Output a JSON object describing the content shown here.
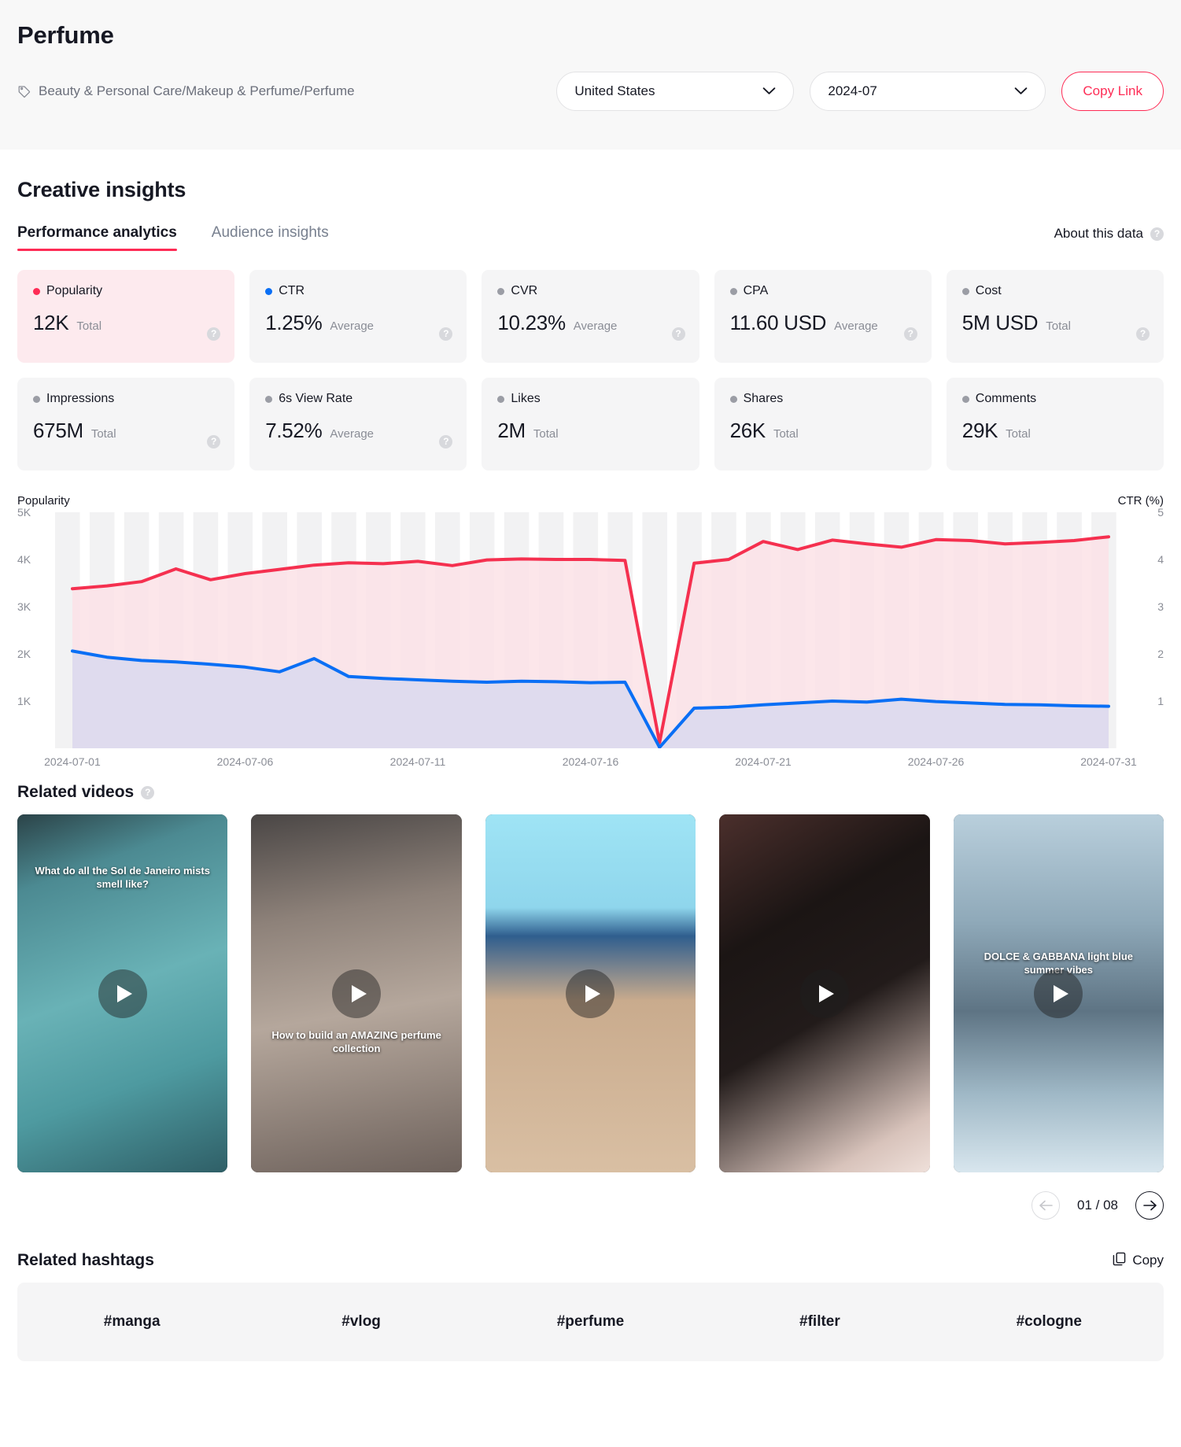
{
  "header": {
    "title": "Perfume",
    "breadcrumb": "Beauty & Personal Care/Makeup & Perfume/Perfume",
    "tag_icon": "tag-icon",
    "country_select": "United States",
    "period_select": "2024-07",
    "copy_link_label": "Copy Link",
    "chevron_icon": "chevron-down-icon"
  },
  "insights": {
    "section_title": "Creative insights",
    "tabs": [
      {
        "label": "Performance analytics",
        "active": true
      },
      {
        "label": "Audience insights",
        "active": false
      }
    ],
    "about_label": "About this data",
    "help_icon": "question-mark-icon",
    "accent_color": "#fe2c55",
    "blue_color": "#0a6ff5"
  },
  "metrics": [
    {
      "label": "Popularity",
      "value": "12K",
      "unit": "Total",
      "dot": "red",
      "highlight": true
    },
    {
      "label": "CTR",
      "value": "1.25%",
      "unit": "Average",
      "dot": "blue",
      "highlight": false
    },
    {
      "label": "CVR",
      "value": "10.23%",
      "unit": "Average",
      "dot": "grey",
      "highlight": false
    },
    {
      "label": "CPA",
      "value": "11.60 USD",
      "unit": "Average",
      "dot": "grey",
      "highlight": false
    },
    {
      "label": "Cost",
      "value": "5M USD",
      "unit": "Total",
      "dot": "grey",
      "highlight": false
    },
    {
      "label": "Impressions",
      "value": "675M",
      "unit": "Total",
      "dot": "grey",
      "highlight": false
    },
    {
      "label": "6s View Rate",
      "value": "7.52%",
      "unit": "Average",
      "dot": "grey",
      "highlight": false
    },
    {
      "label": "Likes",
      "value": "2M",
      "unit": "Total",
      "dot": "grey",
      "highlight": false
    },
    {
      "label": "Shares",
      "value": "26K",
      "unit": "Total",
      "dot": "grey",
      "highlight": false
    },
    {
      "label": "Comments",
      "value": "29K",
      "unit": "Total",
      "dot": "grey",
      "highlight": false
    }
  ],
  "chart_data": {
    "type": "area",
    "title": "",
    "left_axis_label": "Popularity",
    "right_axis_label": "CTR (%)",
    "xlabel": "",
    "grid": true,
    "legend_position": "none",
    "x": [
      "2024-07-01",
      "2024-07-02",
      "2024-07-03",
      "2024-07-04",
      "2024-07-05",
      "2024-07-06",
      "2024-07-07",
      "2024-07-08",
      "2024-07-09",
      "2024-07-10",
      "2024-07-11",
      "2024-07-12",
      "2024-07-13",
      "2024-07-14",
      "2024-07-15",
      "2024-07-16",
      "2024-07-17",
      "2024-07-18",
      "2024-07-19",
      "2024-07-20",
      "2024-07-21",
      "2024-07-22",
      "2024-07-23",
      "2024-07-24",
      "2024-07-25",
      "2024-07-26",
      "2024-07-27",
      "2024-07-28",
      "2024-07-29",
      "2024-07-30",
      "2024-07-31"
    ],
    "x_tick_labels": [
      "2024-07-01",
      "2024-07-06",
      "2024-07-11",
      "2024-07-16",
      "2024-07-21",
      "2024-07-26",
      "2024-07-31"
    ],
    "x_tick_indices": [
      0,
      5,
      10,
      15,
      20,
      25,
      30
    ],
    "left_axis": {
      "label": "Popularity",
      "ticks": [
        "1K",
        "2K",
        "3K",
        "4K",
        "5K"
      ],
      "tick_values": [
        1000,
        2000,
        3000,
        4000,
        5000
      ],
      "min": 0,
      "max": 5000
    },
    "right_axis": {
      "label": "CTR (%)",
      "ticks": [
        "1",
        "2",
        "3",
        "4",
        "5"
      ],
      "tick_values": [
        1,
        2,
        3,
        4,
        5
      ],
      "min": 0,
      "max": 5
    },
    "series": [
      {
        "name": "Popularity",
        "color": "#f5304f",
        "fill": "#fbe2e6",
        "axis": "left",
        "values": [
          3380,
          3440,
          3530,
          3800,
          3570,
          3700,
          3790,
          3880,
          3930,
          3910,
          3960,
          3870,
          3990,
          4010,
          4000,
          4000,
          3980,
          120,
          3920,
          4000,
          4380,
          4210,
          4410,
          4330,
          4260,
          4420,
          4400,
          4330,
          4360,
          4400,
          4480
        ]
      },
      {
        "name": "CTR",
        "color": "#0a6ff5",
        "fill": "#dcd9ee",
        "axis": "right",
        "values": [
          2.06,
          1.93,
          1.86,
          1.83,
          1.78,
          1.72,
          1.62,
          1.9,
          1.52,
          1.48,
          1.45,
          1.42,
          1.4,
          1.42,
          1.41,
          1.39,
          1.4,
          0.02,
          0.85,
          0.87,
          0.92,
          0.96,
          1.0,
          0.98,
          1.04,
          0.99,
          0.96,
          0.93,
          0.92,
          0.9,
          0.89
        ]
      }
    ]
  },
  "related_videos": {
    "title": "Related videos",
    "help_icon": "question-mark-icon",
    "items": [
      {
        "caption": "What do all the Sol de Janeiro mists smell like?",
        "play_icon": "play-icon"
      },
      {
        "caption": "How to build an AMAZING perfume collection",
        "play_icon": "play-icon"
      },
      {
        "caption": "",
        "play_icon": "play-icon"
      },
      {
        "caption": "",
        "play_icon": "play-icon"
      },
      {
        "caption": "DOLCE & GABBANA light blue summer vibes",
        "play_icon": "play-icon"
      }
    ],
    "pager": {
      "counter": "01 / 08",
      "prev_icon": "arrow-left-icon",
      "next_icon": "arrow-right-icon",
      "prev_disabled": true
    }
  },
  "related_hashtags": {
    "title": "Related hashtags",
    "copy_label": "Copy",
    "copy_icon": "copy-icon",
    "items": [
      "#manga",
      "#vlog",
      "#perfume",
      "#filter",
      "#cologne"
    ]
  }
}
